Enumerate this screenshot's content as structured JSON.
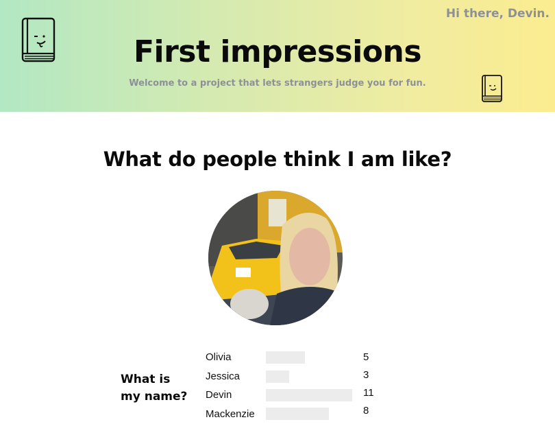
{
  "header": {
    "greeting": "Hi there, Devin.",
    "title": "First impressions",
    "subtitle": "Welcome to a project that lets strangers judge you for fun.",
    "gradient_start": "#b2e8c3",
    "gradient_end": "#fbec8f",
    "logo_icon": "book-face-icon"
  },
  "main": {
    "question": "What do people think I am like?",
    "profile_photo": "profile-photo",
    "poll": {
      "label_line1": "What is",
      "label_line2": "my name?",
      "options": [
        {
          "name": "Olivia",
          "votes": "5"
        },
        {
          "name": "Jessica",
          "votes": "3"
        },
        {
          "name": "Devin",
          "votes": "11"
        },
        {
          "name": "Mackenzie",
          "votes": "8"
        }
      ],
      "bar_color": "#ececec"
    }
  }
}
